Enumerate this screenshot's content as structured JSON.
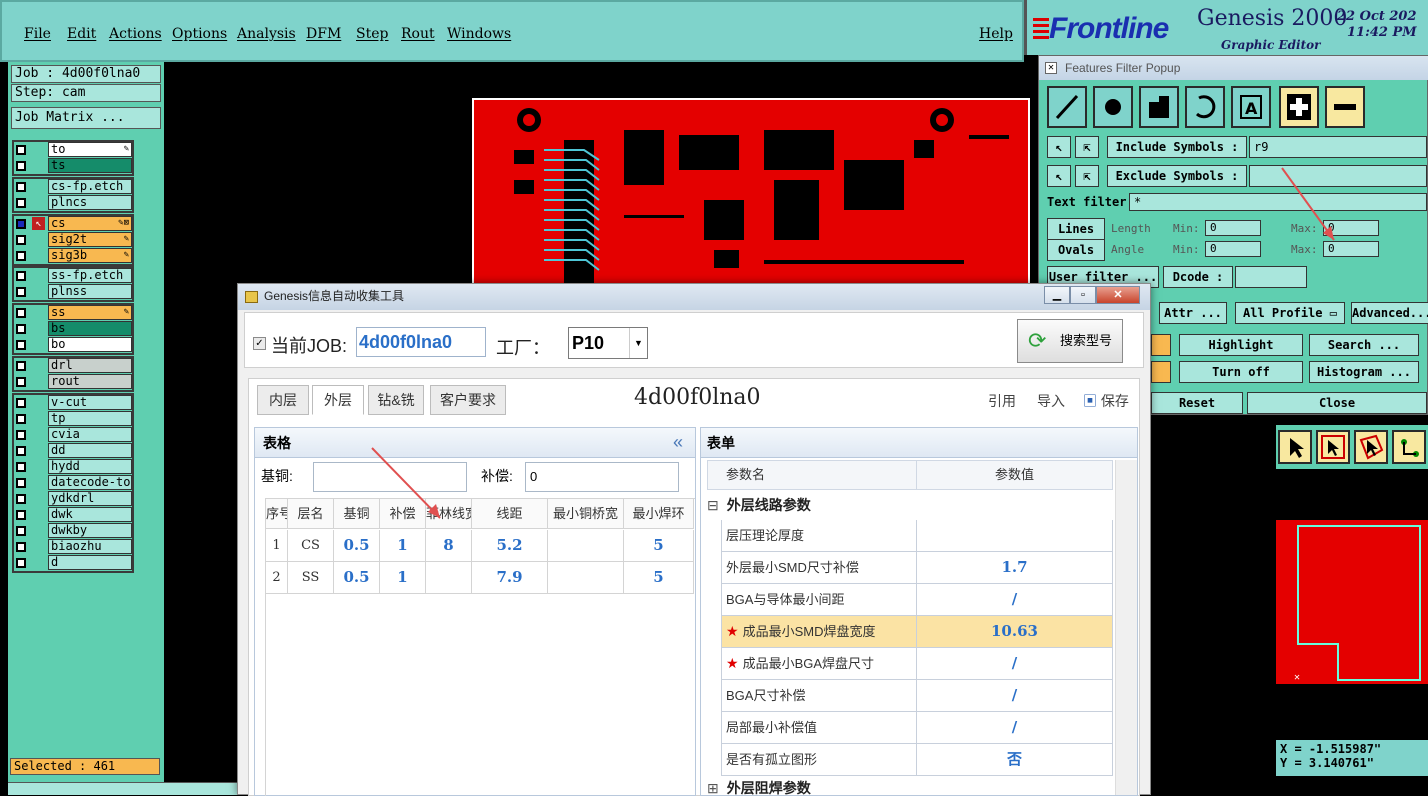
{
  "menu": {
    "items": [
      "File",
      "Edit",
      "Actions",
      "Options",
      "Analysis",
      "DFM",
      "Step",
      "Rout",
      "Windows"
    ],
    "help": "Help"
  },
  "brand": {
    "logo": "Frontline",
    "product": "Genesis 2000",
    "subtitle": "Graphic Editor",
    "date": "22 Oct 202",
    "time": "11:42 PM"
  },
  "job": {
    "job_label": "Job : 4d00f0lna0",
    "step_label": "Step: cam",
    "matrix_button": "Job Matrix ..."
  },
  "layers": {
    "group1": [
      {
        "name": "to",
        "style": "wh",
        "mark": "✎"
      },
      {
        "name": "ts",
        "style": "gr",
        "mark": ""
      }
    ],
    "group2": [
      {
        "name": "cs-fp.etch",
        "style": "",
        "mark": ""
      },
      {
        "name": "plncs",
        "style": "",
        "mark": ""
      }
    ],
    "group3": [
      {
        "name": "cs",
        "style": "or",
        "mark": "✎⊠"
      },
      {
        "name": "sig2t",
        "style": "or",
        "mark": "✎"
      },
      {
        "name": "sig3b",
        "style": "or",
        "mark": "✎"
      }
    ],
    "group4": [
      {
        "name": "ss-fp.etch",
        "style": "",
        "mark": ""
      },
      {
        "name": "plnss",
        "style": "",
        "mark": ""
      }
    ],
    "group5": [
      {
        "name": "ss",
        "style": "or",
        "mark": "✎"
      },
      {
        "name": "bs",
        "style": "gr",
        "mark": ""
      },
      {
        "name": "bo",
        "style": "wh",
        "mark": ""
      }
    ],
    "group6": [
      {
        "name": "drl",
        "style": "gy",
        "mark": ""
      },
      {
        "name": "rout",
        "style": "gy",
        "mark": ""
      }
    ],
    "group7": [
      {
        "name": "v-cut",
        "style": "",
        "mark": ""
      },
      {
        "name": "tp",
        "style": "",
        "mark": ""
      },
      {
        "name": "cvia",
        "style": "",
        "mark": ""
      },
      {
        "name": "dd",
        "style": "",
        "mark": ""
      },
      {
        "name": "hydd",
        "style": "",
        "mark": ""
      },
      {
        "name": "datecode-to",
        "style": "",
        "mark": ""
      },
      {
        "name": "ydkdrl",
        "style": "",
        "mark": ""
      },
      {
        "name": "dwk",
        "style": "",
        "mark": ""
      },
      {
        "name": "dwkby",
        "style": "",
        "mark": ""
      },
      {
        "name": "biaozhu",
        "style": "",
        "mark": ""
      },
      {
        "name": "d",
        "style": "",
        "mark": ""
      }
    ]
  },
  "status": {
    "selected": "Selected : 461"
  },
  "filter": {
    "title": "Features Filter Popup",
    "include_label": "Include Symbols :",
    "include_value": "r9",
    "exclude_label": "Exclude Symbols :",
    "exclude_value": "",
    "text_filter_label": "Text filter",
    "text_filter_value": "*",
    "lines": "Lines",
    "ovals": "Ovals",
    "length": "Length",
    "angle": "Angle",
    "min": "Min:",
    "max": "Max:",
    "zero": "0",
    "user_filter": "User filter ...",
    "dcode": "Dcode :",
    "attr": "Attr ...",
    "all_profile": "All Profile",
    "advanced": "Advanced...",
    "highlight": "Highlight",
    "search": "Search ...",
    "turn_off": "Turn off",
    "histogram": "Histogram ...",
    "reset": "Reset",
    "close": "Close"
  },
  "coords": {
    "x": "X = -1.515987\"",
    "y": "Y = 3.140761\""
  },
  "dialog": {
    "title": "Genesis信息自动收集工具",
    "job_label": "当前JOB:",
    "job_value": "4d00f0lna0",
    "factory_label": "工厂：",
    "factory_value": "P10",
    "search_button": "搜索型号",
    "tabs": [
      "内层",
      "外层",
      "钻&铣",
      "客户要求"
    ],
    "job_heading": "4d00f0lna0",
    "actions": {
      "ref": "引用",
      "import": "导入",
      "save": "保存"
    },
    "table_panel": {
      "title": "表格",
      "collapse": "«",
      "base_copper_label": "基铜:",
      "base_copper_value": "",
      "comp_label": "补偿:",
      "comp_value": "0",
      "headers": [
        "序号",
        "层名",
        "基铜",
        "补偿",
        "菲林线宽",
        "线距",
        "最小铜桥宽",
        "最小焊环"
      ],
      "rows": [
        [
          "1",
          "CS",
          "0.5",
          "1",
          "8",
          "5.2",
          "",
          "5"
        ],
        [
          "2",
          "SS",
          "0.5",
          "1",
          "",
          "7.9",
          "",
          "5"
        ]
      ]
    },
    "form_panel": {
      "title": "表单",
      "col_name": "参数名",
      "col_value": "参数值",
      "section1": "外层线路参数",
      "section2": "外层阻焊参数",
      "rows": [
        {
          "name": "层压理论厚度",
          "value": "",
          "star": false
        },
        {
          "name": "外层最小SMD尺寸补偿",
          "value": "1.7",
          "star": false
        },
        {
          "name": "BGA与导体最小间距",
          "value": "/",
          "star": false
        },
        {
          "name": "成品最小SMD焊盘宽度",
          "value": "10.63",
          "star": true
        },
        {
          "name": "成品最小BGA焊盘尺寸",
          "value": "/",
          "star": true
        },
        {
          "name": "BGA尺寸补偿",
          "value": "/",
          "star": false
        },
        {
          "name": "局部最小补偿值",
          "value": "/",
          "star": false
        },
        {
          "name": "是否有孤立图形",
          "value": "否",
          "star": false
        }
      ]
    }
  }
}
